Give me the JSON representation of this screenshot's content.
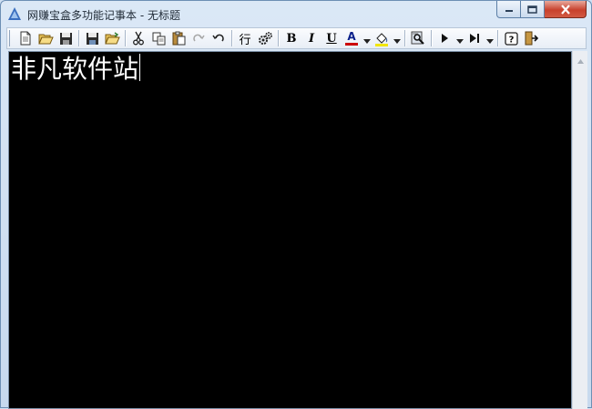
{
  "window": {
    "title": "网赚宝盒多功能记事本 - 无标题",
    "caption_buttons": [
      "minimize-icon",
      "maximize-icon",
      "close-icon"
    ]
  },
  "toolbar": {
    "line_label": "行",
    "bold_label": "B",
    "italic_label": "I",
    "underline_label": "U",
    "font_color_label": "A",
    "font_color": "#cc0000",
    "fill_color": "#f2e600",
    "icons": [
      "new-file-icon",
      "open-folder-icon",
      "save-icon",
      "save-as-icon",
      "open-icon",
      "cut-icon",
      "copy-icon",
      "paste-icon",
      "redo-icon",
      "undo-icon",
      "line-icon",
      "settings-icon",
      "bold-icon",
      "italic-icon",
      "underline-icon",
      "font-color-icon",
      "fill-color-icon",
      "find-replace-icon",
      "play-icon",
      "step-icon",
      "help-icon",
      "exit-icon"
    ]
  },
  "editor": {
    "text": "非凡软件站",
    "background": "#000000",
    "text_color": "#ffffff"
  }
}
